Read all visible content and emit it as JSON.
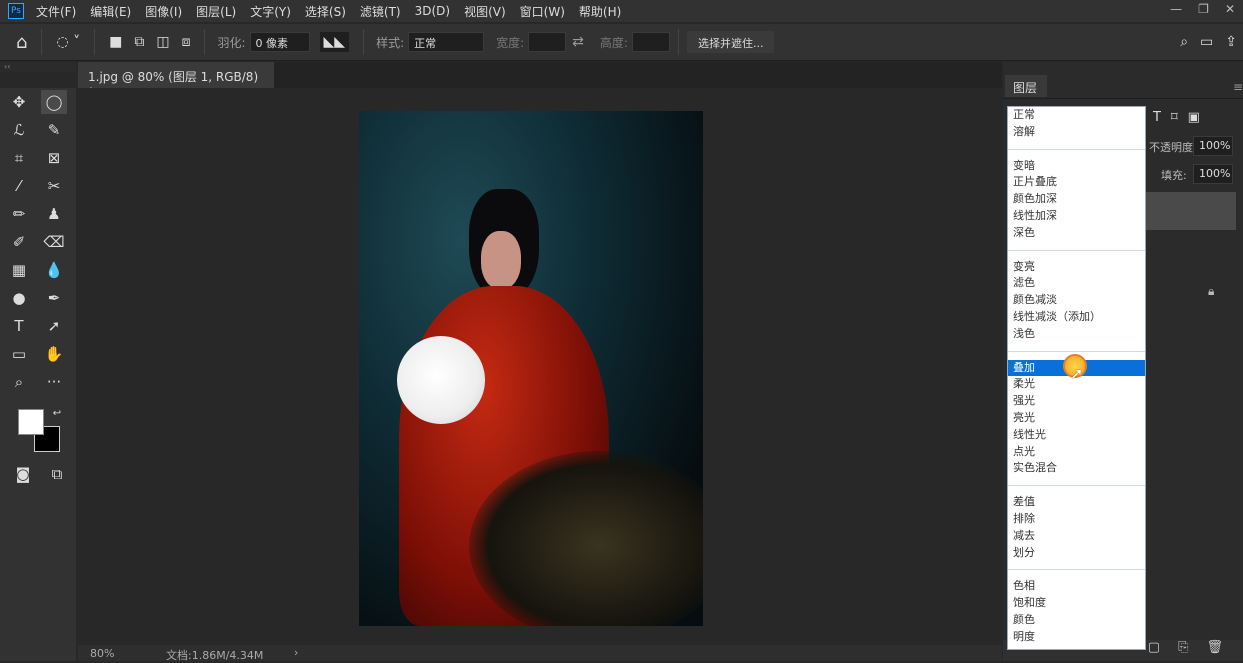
{
  "app": {
    "logo": "Ps",
    "menus": [
      "文件(F)",
      "编辑(E)",
      "图像(I)",
      "图层(L)",
      "文字(Y)",
      "选择(S)",
      "滤镜(T)",
      "3D(D)",
      "视图(V)",
      "窗口(W)",
      "帮助(H)"
    ]
  },
  "options": {
    "feather_label": "羽化:",
    "feather_value": "0 像素",
    "style_label": "样式:",
    "style_value": "正常",
    "width_label": "宽度:",
    "height_label": "高度:",
    "select_mask": "选择并遮住..."
  },
  "document": {
    "tab_title": "1.jpg @ 80% (图层 1, RGB/8) *",
    "close": "×"
  },
  "status": {
    "zoom": "80%",
    "doc": "文档:1.86M/4.34M",
    "arrow": "›"
  },
  "layers": {
    "tab": "图层",
    "opacity_label": "不透明度:",
    "opacity": "100%",
    "fill_label": "填充:",
    "fill": "100%"
  },
  "blend_modes": {
    "selected": "叠加",
    "groups": [
      [
        "正常",
        "溶解"
      ],
      [
        "变暗",
        "正片叠底",
        "颜色加深",
        "线性加深",
        "深色"
      ],
      [
        "变亮",
        "滤色",
        "颜色减淡",
        "线性减淡（添加）",
        "浅色"
      ],
      [
        "叠加",
        "柔光",
        "强光",
        "亮光",
        "线性光",
        "点光",
        "实色混合"
      ],
      [
        "差值",
        "排除",
        "减去",
        "划分"
      ],
      [
        "色相",
        "饱和度",
        "颜色",
        "明度"
      ]
    ]
  }
}
